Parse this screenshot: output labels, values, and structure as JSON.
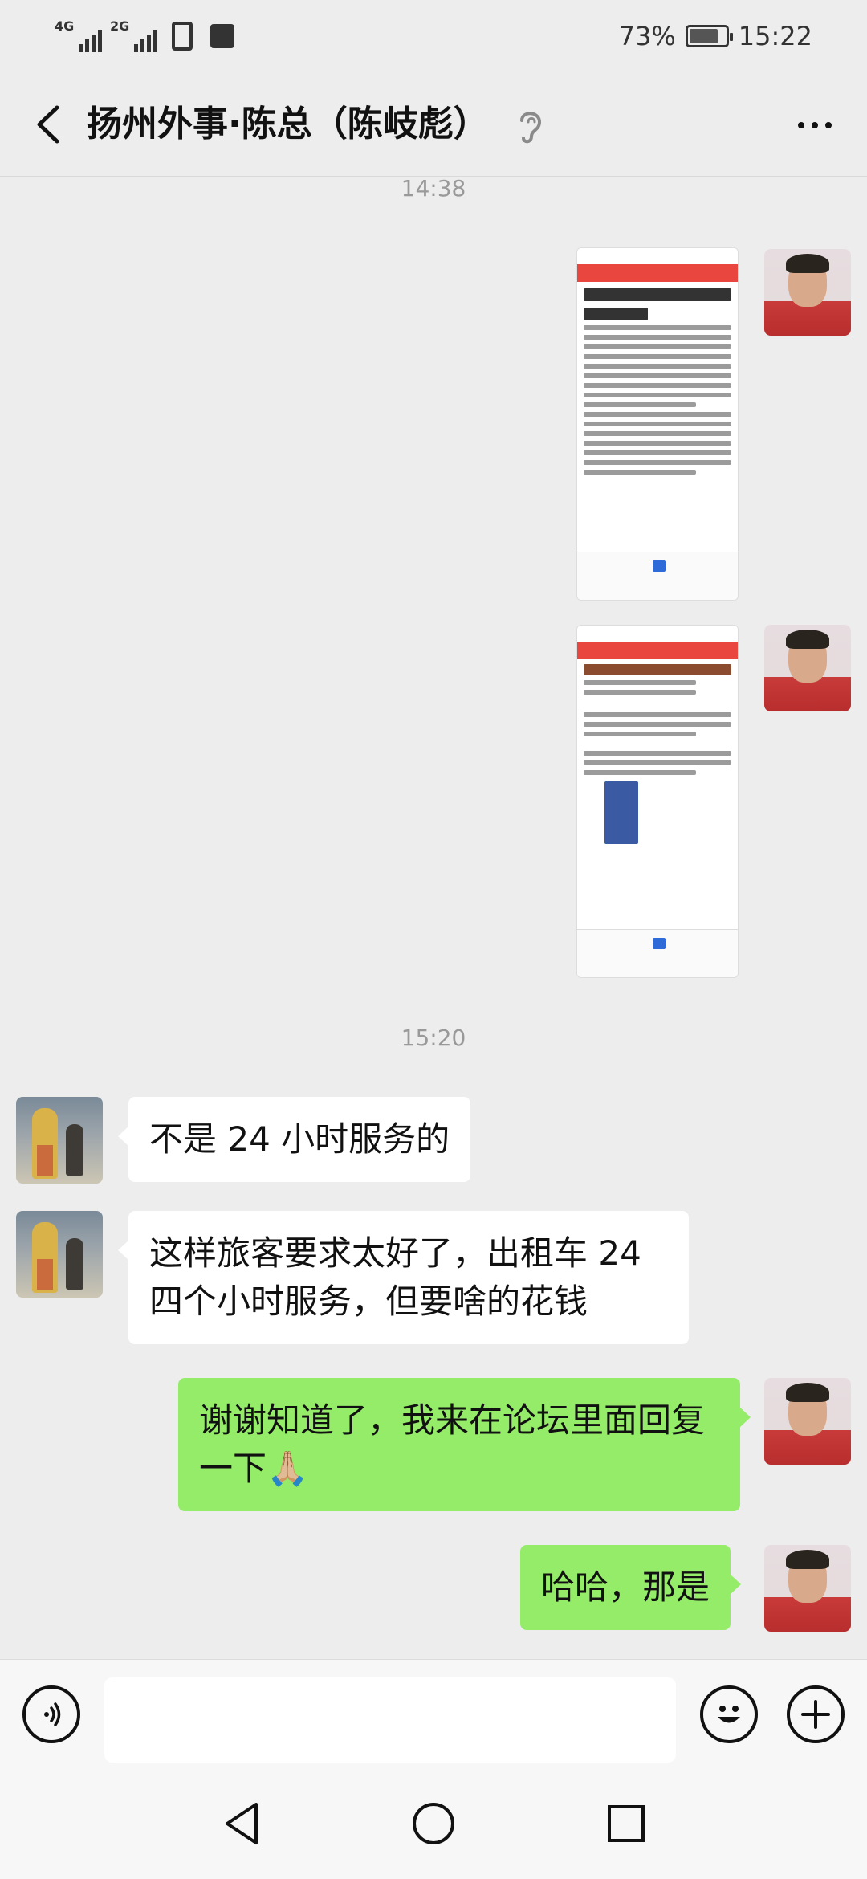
{
  "status_bar": {
    "network1": "4G",
    "network2": "2G",
    "battery_percent": "73%",
    "battery_level": 0.73,
    "time": "15:22"
  },
  "header": {
    "title": "扬州外事·陈总（陈岐彪）",
    "icons": [
      "back-arrow-icon",
      "ear-icon",
      "more-icon"
    ]
  },
  "chat": {
    "timestamp1": "14:38",
    "timestamp2": "15:20",
    "messages": [
      {
        "side": "right",
        "type": "image",
        "content": "screenshot of forum post"
      },
      {
        "side": "right",
        "type": "image",
        "content": "screenshot of forum replies"
      },
      {
        "side": "left",
        "type": "text",
        "text": "不是 24 小时服务的"
      },
      {
        "side": "left",
        "type": "text",
        "text": "这样旅客要求太好了，出租车 24 四个小时服务，但要啥的花钱"
      },
      {
        "side": "right",
        "type": "text",
        "text": "谢谢知道了，我来在论坛里面回复一下🙏🏼"
      },
      {
        "side": "right",
        "type": "text",
        "text": "哈哈，那是"
      }
    ]
  },
  "input_bar": {
    "icons": [
      "voice-icon",
      "emoji-icon",
      "plus-icon"
    ],
    "value": ""
  },
  "nav_bar": {
    "icons": [
      "nav-back-icon",
      "nav-home-icon",
      "nav-recents-icon"
    ]
  },
  "colors": {
    "background": "#ededed",
    "sent_bubble": "#95ec69",
    "received_bubble": "#ffffff",
    "timestamp": "#999999"
  }
}
